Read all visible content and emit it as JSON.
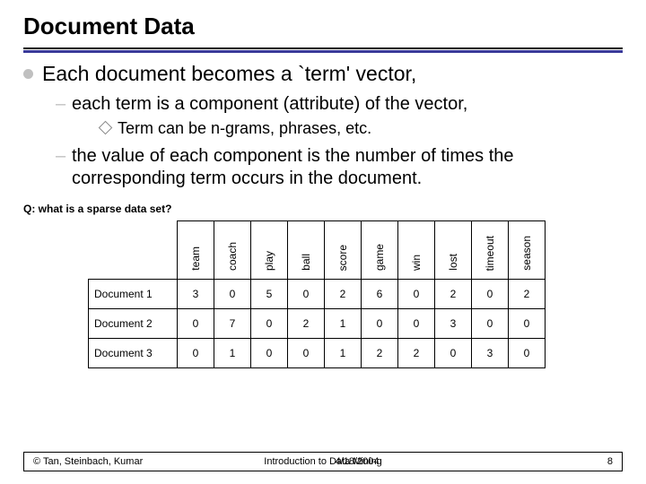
{
  "title": "Document Data",
  "bullets": {
    "b1": "Each document becomes a `term' vector,",
    "b2a": "each term is a component (attribute) of the vector,",
    "b3": "Term can be n-grams, phrases, etc.",
    "b2b": "the value of each component is the number of times the corresponding term occurs in the document."
  },
  "question": "Q: what is a sparse data set?",
  "chart_data": {
    "type": "table",
    "columns": [
      "team",
      "coach",
      "play",
      "ball",
      "score",
      "game",
      "win",
      "lost",
      "timeout",
      "season"
    ],
    "bold_columns": [
      "season"
    ],
    "rows": [
      {
        "label": "Document 1",
        "values": [
          3,
          0,
          5,
          0,
          2,
          6,
          0,
          2,
          0,
          2
        ]
      },
      {
        "label": "Document 2",
        "values": [
          0,
          7,
          0,
          2,
          1,
          0,
          0,
          3,
          0,
          0
        ]
      },
      {
        "label": "Document 3",
        "values": [
          0,
          1,
          0,
          0,
          1,
          2,
          2,
          0,
          3,
          0
        ]
      }
    ]
  },
  "footer": {
    "left": "© Tan, Steinbach, Kumar",
    "center": "Introduction to Data Mining",
    "right": "4/18/2004",
    "page": "8"
  }
}
